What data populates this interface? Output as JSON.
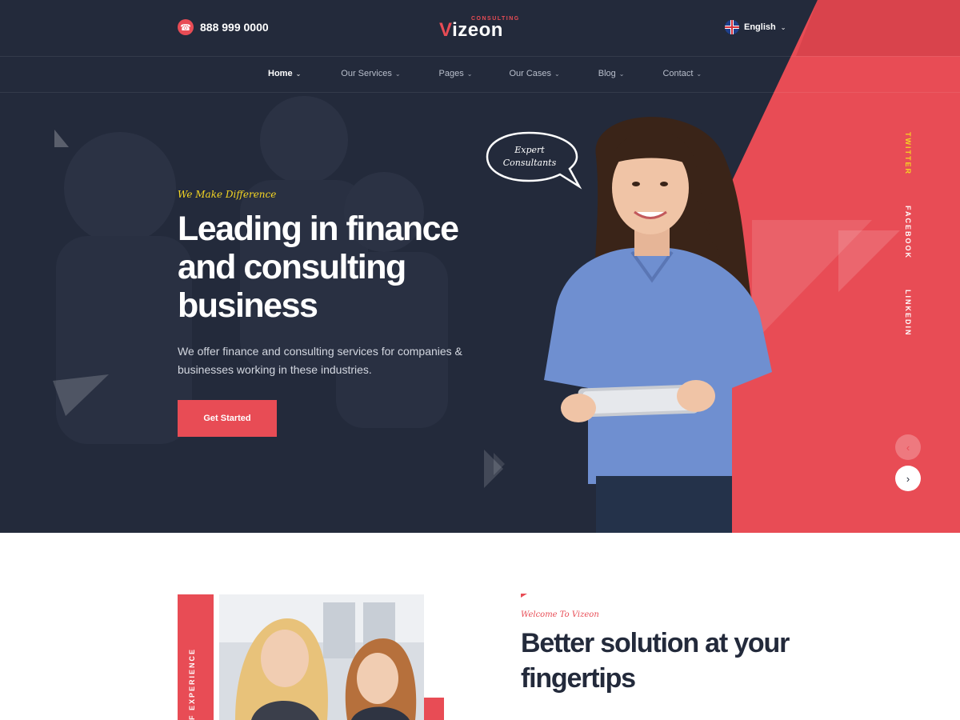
{
  "header": {
    "phone": "888 999 0000",
    "logo_main": "Vizeon",
    "logo_sub": "CONSULTING",
    "language": "English"
  },
  "nav": {
    "items": [
      {
        "label": "Home",
        "active": true
      },
      {
        "label": "Our Services",
        "active": false
      },
      {
        "label": "Pages",
        "active": false
      },
      {
        "label": "Our Cases",
        "active": false
      },
      {
        "label": "Blog",
        "active": false
      },
      {
        "label": "Contact",
        "active": false
      }
    ]
  },
  "hero": {
    "tagline": "We Make Difference",
    "headline": "Leading in finance and consulting business",
    "subtext": "We offer finance and consulting services for companies & businesses working in these industries.",
    "cta_label": "Get Started",
    "bubble_text": "Expert Consultants"
  },
  "social": {
    "items": [
      "TWITTER",
      "FACEBOOK",
      "LINKEDIN"
    ]
  },
  "slider": {
    "prev_icon": "chevron-left-icon",
    "next_icon": "chevron-right-icon"
  },
  "about": {
    "strip_text": "F EXPERIENCE",
    "eyebrow": "Welcome To Vizeon",
    "title": "Better solution at your fingertips"
  },
  "colors": {
    "accent": "#e84c55",
    "dark": "#232a3b",
    "highlight": "#f5d623"
  }
}
